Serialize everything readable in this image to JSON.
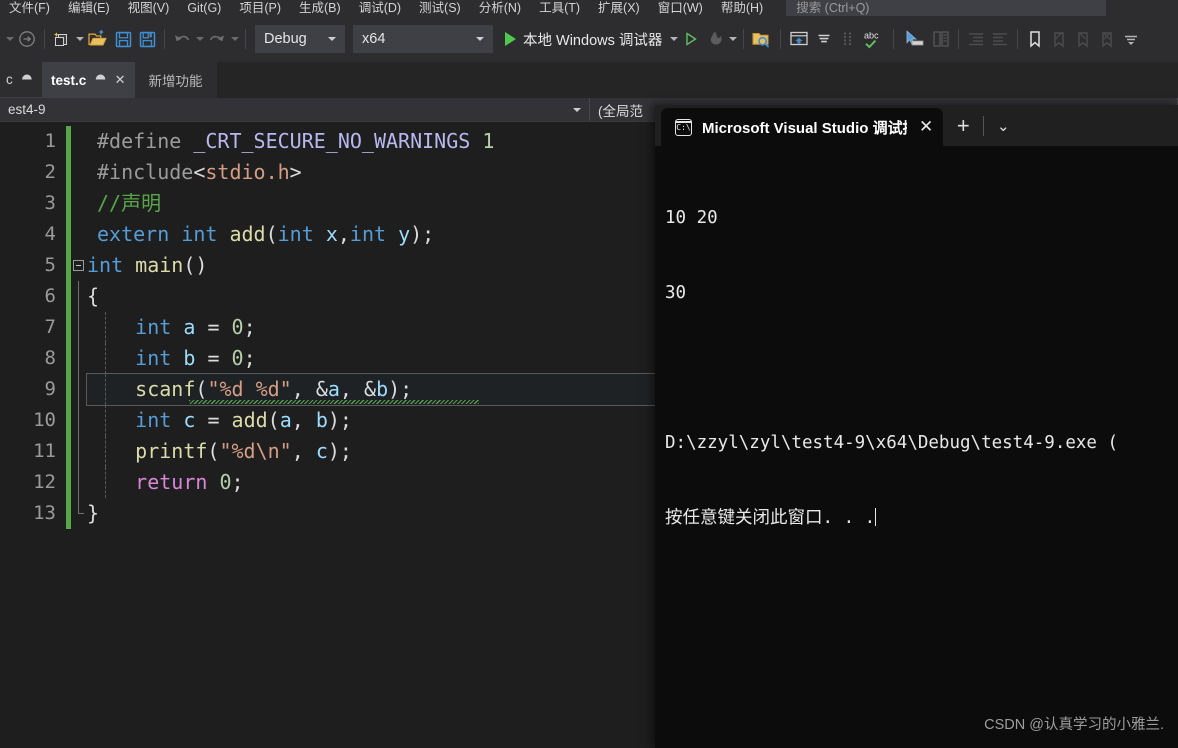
{
  "menubar": {
    "items": [
      {
        "label": "文件(F)"
      },
      {
        "label": "编辑(E)"
      },
      {
        "label": "视图(V)"
      },
      {
        "label": "Git(G)"
      },
      {
        "label": "项目(P)"
      },
      {
        "label": "生成(B)"
      },
      {
        "label": "调试(D)"
      },
      {
        "label": "测试(S)"
      },
      {
        "label": "分析(N)"
      },
      {
        "label": "工具(T)"
      },
      {
        "label": "扩展(X)"
      },
      {
        "label": "窗口(W)"
      },
      {
        "label": "帮助(H)"
      }
    ],
    "search_placeholder": "搜索 (Ctrl+Q)"
  },
  "toolbar": {
    "config_value": "Debug",
    "platform_value": "x64",
    "run_label": "本地 Windows 调试器",
    "icons": [
      "navigate-backward-icon",
      "navigate-forward-icon",
      "new-item-icon",
      "open-file-icon",
      "save-icon",
      "save-all-icon",
      "undo-icon",
      "redo-icon",
      "start-debug-icon",
      "hot-reload-icon",
      "find-in-files-icon",
      "solution-platform-icon",
      "spell-check-icon",
      "pointer-icon",
      "compare-icon",
      "indent-icon",
      "outdent-icon",
      "bookmark-icon",
      "prev-bookmark-icon",
      "next-bookmark-icon",
      "clear-bookmarks-icon",
      "overflow-icon"
    ]
  },
  "tabstrip": {
    "tool_tab_label": "c",
    "file_tab_name": "test.c",
    "ghost_tab_label": "新增功能"
  },
  "navbar": {
    "scope_left": "est4-9",
    "scope_right": "(全局范"
  },
  "editor": {
    "lines": [
      {
        "n": "1",
        "text": "#define _CRT_SECURE_NO_WARNINGS 1"
      },
      {
        "n": "2",
        "text": "#include<stdio.h>"
      },
      {
        "n": "3",
        "text": "//声明"
      },
      {
        "n": "4",
        "text": "extern int add(int x,int y);"
      },
      {
        "n": "5",
        "text": "int main()"
      },
      {
        "n": "6",
        "text": "{"
      },
      {
        "n": "7",
        "text": "    int a = 0;"
      },
      {
        "n": "8",
        "text": "    int b = 0;"
      },
      {
        "n": "9",
        "text": "    scanf(\"%d %d\", &a, &b);"
      },
      {
        "n": "10",
        "text": "    int c = add(a, b);"
      },
      {
        "n": "11",
        "text": "    printf(\"%d\\n\", c);"
      },
      {
        "n": "12",
        "text": "    return 0;"
      },
      {
        "n": "13",
        "text": "}"
      }
    ]
  },
  "console": {
    "tab_title": "Microsoft Visual Studio 调试控",
    "new_tab_label": "+",
    "chevron_label": "⌄",
    "close_label": "✕",
    "output": [
      "10 20",
      "30",
      "",
      "D:\\zzyl\\zyl\\test4-9\\x64\\Debug\\test4-9.exe (",
      "按任意键关闭此窗口. . ."
    ]
  },
  "watermark": {
    "text": "CSDN @认真学习的小雅兰."
  },
  "colors": {
    "accent_green": "#57a64a",
    "keyword_blue": "#569cd6",
    "string_orange": "#d69d85",
    "editor_bg": "#1e1e1e",
    "chrome_bg": "#2d2d30",
    "console_bg": "#0c0c0c"
  }
}
